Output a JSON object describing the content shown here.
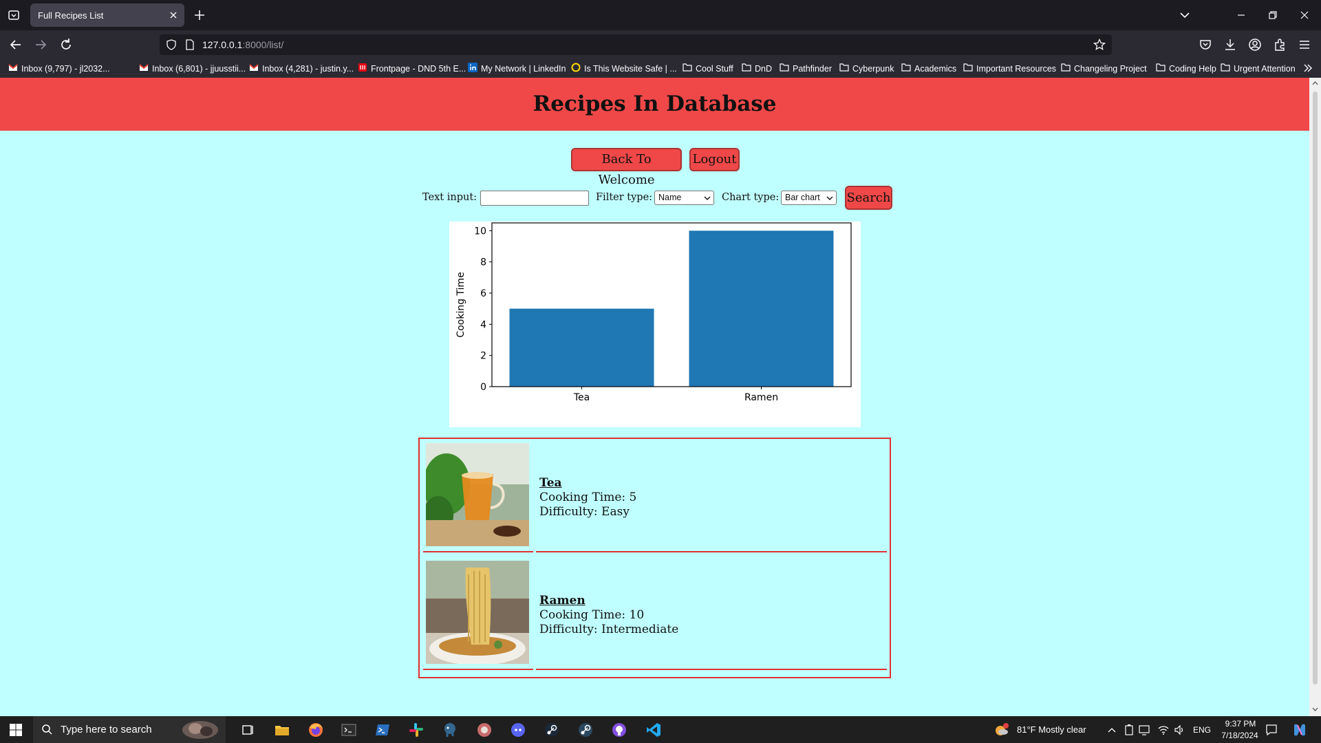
{
  "browser": {
    "tab_title": "Full Recipes List",
    "url_host": "127.0.0.1",
    "url_path": ":8000/list/",
    "bookmarks": [
      {
        "label": "Inbox (9,797) - jl2032...",
        "icon": "gmail-icon"
      },
      {
        "label": "Inbox (6,801) - jjuusstii...",
        "icon": "gmail-icon"
      },
      {
        "label": "Inbox (4,281) - justin.y...",
        "icon": "gmail-icon"
      },
      {
        "label": "Frontpage - DND 5th E...",
        "icon": "dnd-icon"
      },
      {
        "label": "My Network | LinkedIn",
        "icon": "linkedin-icon"
      },
      {
        "label": "Is This Website Safe | ...",
        "icon": "norton-icon"
      },
      {
        "label": "Cool Stuff",
        "icon": "folder-icon"
      },
      {
        "label": "DnD",
        "icon": "folder-icon"
      },
      {
        "label": "Pathfinder",
        "icon": "folder-icon"
      },
      {
        "label": "Cyberpunk",
        "icon": "folder-icon"
      },
      {
        "label": "Academics",
        "icon": "folder-icon"
      },
      {
        "label": "Important Resources",
        "icon": "folder-icon"
      },
      {
        "label": "Changeling Project",
        "icon": "folder-icon"
      },
      {
        "label": "Coding Help",
        "icon": "folder-icon"
      },
      {
        "label": "Urgent Attention",
        "icon": "folder-icon"
      }
    ]
  },
  "page": {
    "title": "Recipes In Database",
    "back_button": "Back To Welcome",
    "logout_button": "Logout",
    "form": {
      "text_input_label": "Text input:",
      "text_input_value": "",
      "filter_label": "Filter type:",
      "filter_value": "Name",
      "chart_label": "Chart type:",
      "chart_value": "Bar chart",
      "search_button": "Search"
    },
    "recipes": [
      {
        "name": "Tea",
        "cooking_time": "Cooking Time: 5",
        "difficulty": "Difficulty: Easy"
      },
      {
        "name": "Ramen",
        "cooking_time": "Cooking Time: 10",
        "difficulty": "Difficulty: Intermediate"
      }
    ]
  },
  "chart_data": {
    "type": "bar",
    "categories": [
      "Tea",
      "Ramen"
    ],
    "values": [
      5,
      10
    ],
    "title": "",
    "xlabel": "",
    "ylabel": "Cooking Time",
    "ylim": [
      0,
      10.5
    ],
    "yticks": [
      0,
      2,
      4,
      6,
      8,
      10
    ],
    "bar_color": "#1f77b4",
    "grid": false
  },
  "taskbar": {
    "search_placeholder": "Type here to search",
    "weather": "81°F  Mostly clear",
    "language": "ENG",
    "time": "9:37 PM",
    "date": "7/18/2024"
  },
  "colors": {
    "header": "#f04848",
    "page_bg": "#c0ffff",
    "accent_border": "#e03030"
  }
}
